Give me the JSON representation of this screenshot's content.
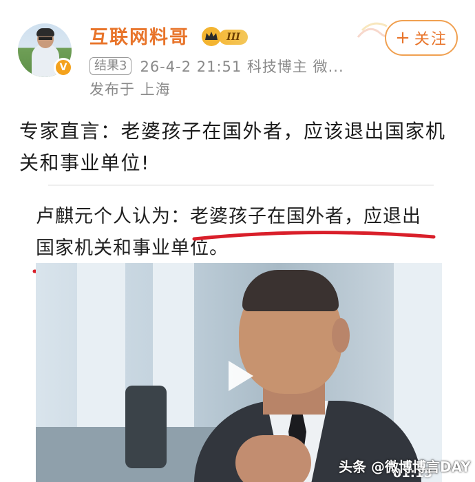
{
  "post": {
    "username": "互联网料哥",
    "vip_level": "III",
    "result_tag": "结果3",
    "meta": "26-4-2 21:51  科技博主 微...",
    "location": "发布于 上海",
    "follow_label": "关注",
    "follow_plus": "+",
    "content": "专家直言：老婆孩子在国外者，应该退出国家机关和事业单位!"
  },
  "embedded": {
    "quote_line1": "卢麒元个人认为：老婆孩子在国外者，应退出",
    "quote_line2": "国家机关和事业单位。",
    "video_duration": "01:15"
  },
  "watermark": "头条 @微博博言DAY",
  "colors": {
    "accent": "#e8742a",
    "underline": "#d91f2a",
    "meta_gray": "#8a8a8a"
  },
  "icons": {
    "verified": "verified-v-icon",
    "vip": "crown-icon",
    "play": "play-icon"
  }
}
